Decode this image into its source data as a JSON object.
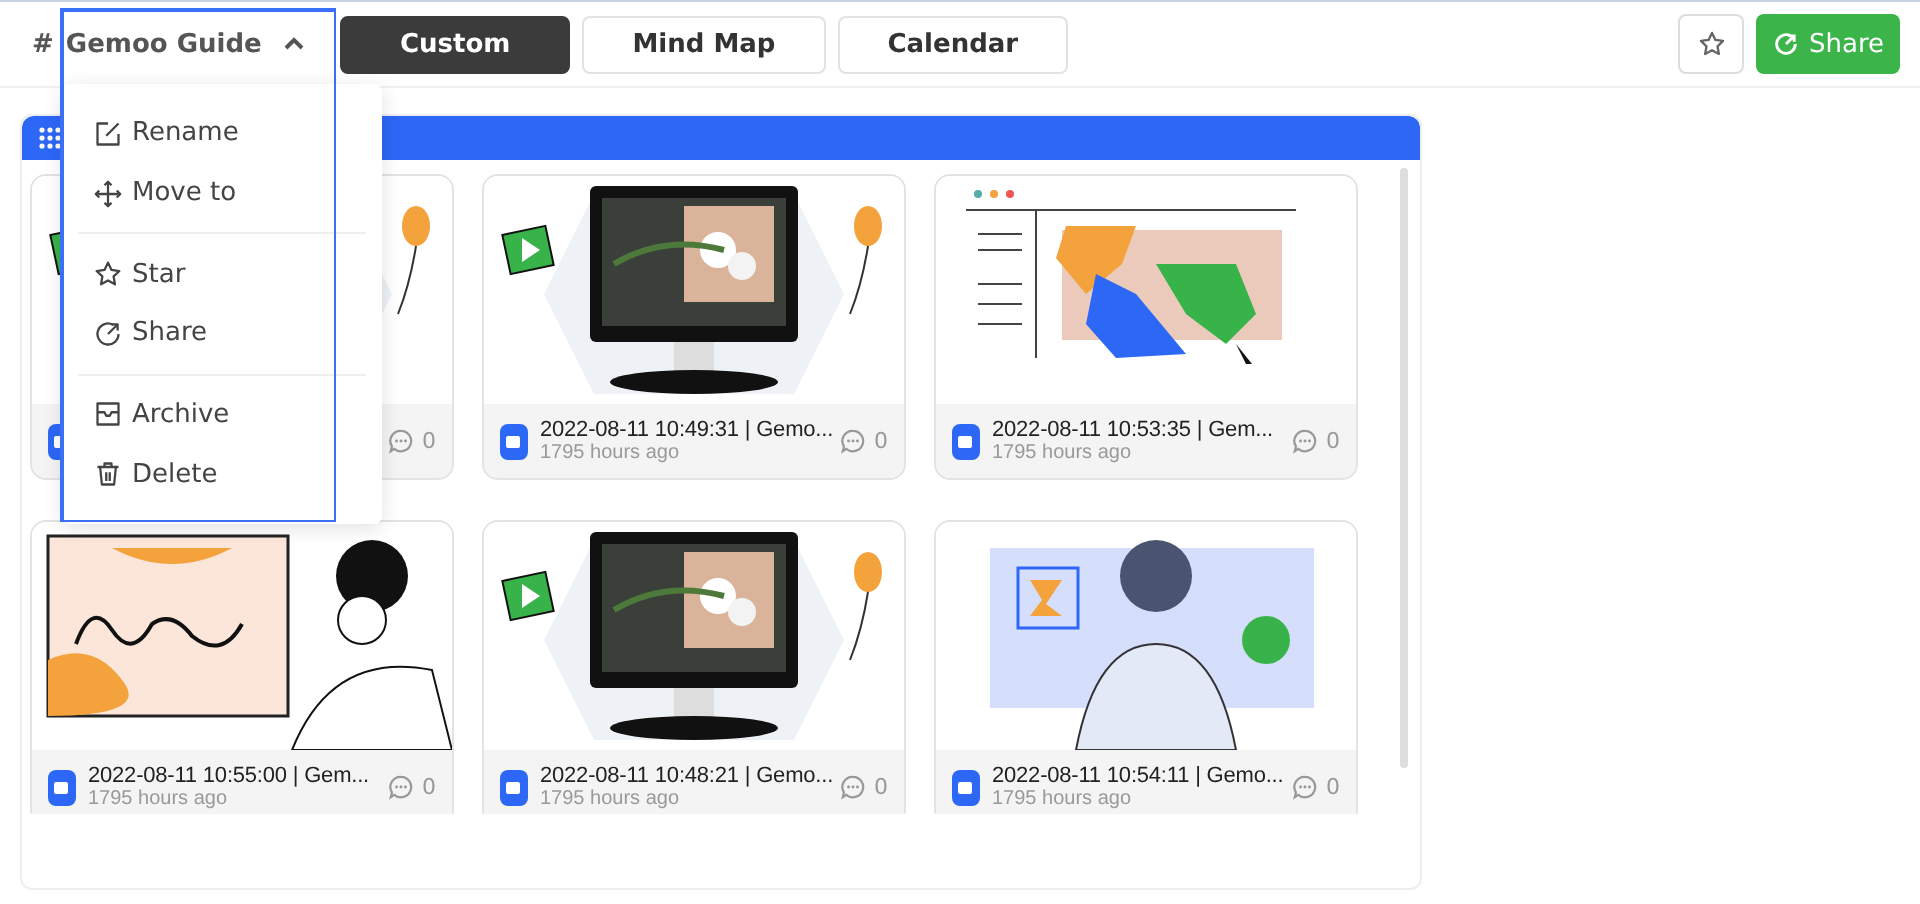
{
  "header": {
    "hash": "#",
    "title": "Gemoo Guide",
    "expanded": true,
    "tabs": [
      {
        "label": "Custom",
        "selected": true
      },
      {
        "label": "Mind Map",
        "selected": false
      },
      {
        "label": "Calendar",
        "selected": false
      }
    ],
    "share_button": "Share"
  },
  "menu": [
    {
      "label": "Rename",
      "kind": "rename"
    },
    {
      "label": "Move to",
      "kind": "move"
    },
    {
      "label": "Star",
      "kind": "star",
      "separator_before": true
    },
    {
      "label": "Share",
      "kind": "share"
    },
    {
      "label": "Archive",
      "kind": "archive",
      "separator_before": true
    },
    {
      "label": "Delete",
      "kind": "delete"
    }
  ],
  "cards": [
    {
      "kind": "monitor",
      "comments": "0"
    },
    {
      "kind": "monitor",
      "title": "2022-08-11 10:49:31 | Gemo...",
      "time": "1795 hours ago",
      "comments": "0"
    },
    {
      "kind": "flow",
      "title": "2022-08-11 10:53:35 | Gem...",
      "time": "1795 hours ago",
      "comments": "0"
    },
    {
      "kind": "writing",
      "title": "2022-08-11 10:55:00 | Gem...",
      "time": "1795 hours ago",
      "comments": "0"
    },
    {
      "kind": "monitor",
      "title": "2022-08-11 10:48:21 | Gemo...",
      "time": "1795 hours ago",
      "comments": "0"
    },
    {
      "kind": "person",
      "title": "2022-08-11 10:54:11 | Gemo...",
      "time": "1795 hours ago",
      "comments": "0"
    }
  ]
}
